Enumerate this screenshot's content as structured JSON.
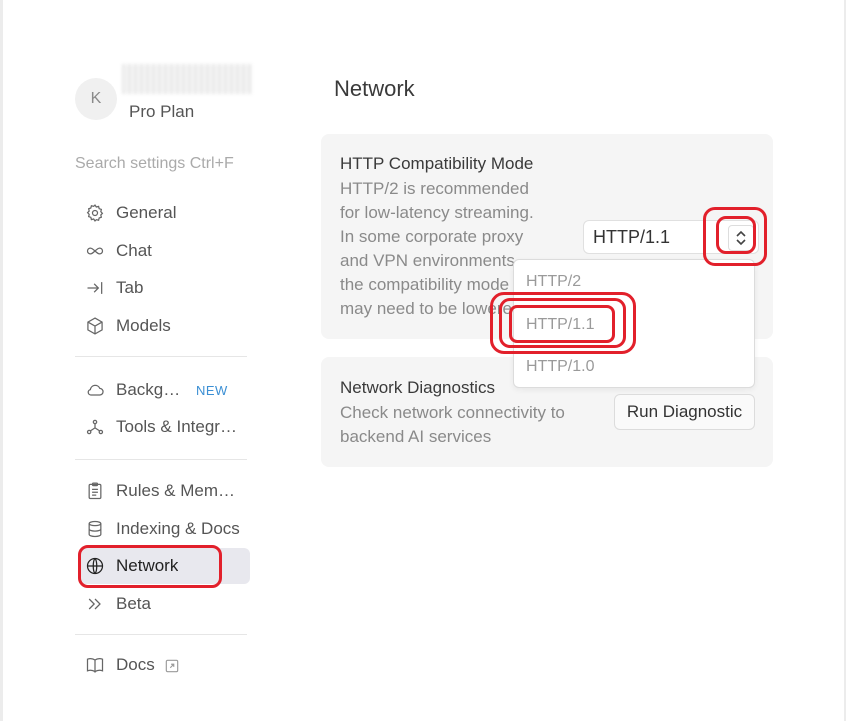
{
  "profile": {
    "avatar_initial": "K",
    "plan": "Pro Plan"
  },
  "search": {
    "placeholder": "Search settings Ctrl+F"
  },
  "sidebar": {
    "items": [
      {
        "label": "General",
        "icon": "gear-icon"
      },
      {
        "label": "Chat",
        "icon": "infinity-icon"
      },
      {
        "label": "Tab",
        "icon": "tab-arrow-icon"
      },
      {
        "label": "Models",
        "icon": "cube-icon"
      },
      {
        "label": "Background Agents",
        "icon": "cloud-icon",
        "badge": "NEW"
      },
      {
        "label": "Tools & Integrations",
        "icon": "tools-icon"
      },
      {
        "label": "Rules & Memories",
        "icon": "clipboard-icon"
      },
      {
        "label": "Indexing & Docs",
        "icon": "database-icon"
      },
      {
        "label": "Network",
        "icon": "globe-icon",
        "active": true
      },
      {
        "label": "Beta",
        "icon": "chevrons-right-icon"
      },
      {
        "label": "Docs",
        "icon": "book-icon",
        "external": true
      }
    ]
  },
  "main": {
    "title": "Network",
    "http_card": {
      "title": "HTTP Compatibility Mode",
      "desc_lines": [
        "HTTP/2 is recommended",
        "for low-latency streaming.",
        "In some corporate proxy",
        "and VPN environments,",
        "the compatibility mode",
        "may need to be lowered."
      ],
      "selected": "HTTP/1.1",
      "options": [
        "HTTP/2",
        "HTTP/1.1",
        "HTTP/1.0"
      ]
    },
    "diagnostics_card": {
      "title": "Network Diagnostics",
      "desc_lines": [
        "Check network connectivity to",
        "backend AI services"
      ],
      "button": "Run Diagnostic"
    }
  },
  "colors": {
    "accent_new": "#3b8fd4",
    "annotation": "#e2202b",
    "active_item_bg": "#e8e8ee"
  }
}
